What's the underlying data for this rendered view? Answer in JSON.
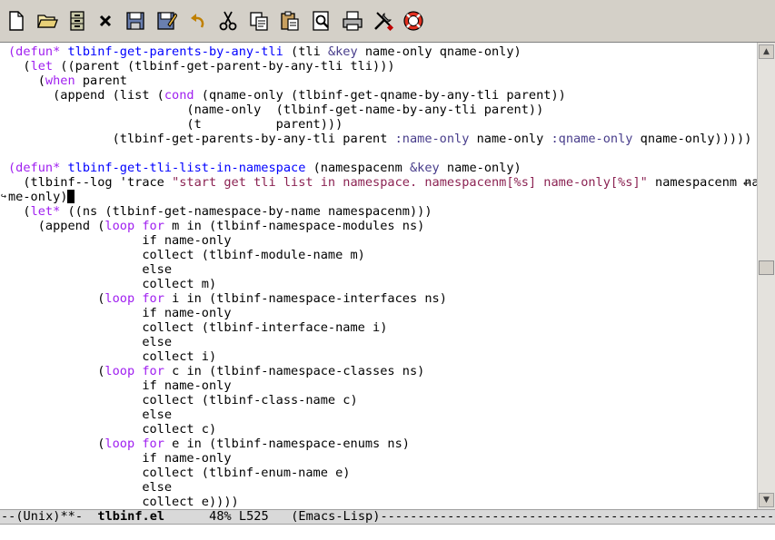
{
  "toolbar": {
    "buttons": [
      {
        "name": "new-file-icon",
        "tooltip": "new"
      },
      {
        "name": "open-folder-icon",
        "tooltip": "open"
      },
      {
        "name": "dired-cabinet-icon",
        "tooltip": "dired"
      },
      {
        "name": "close-icon",
        "tooltip": "close"
      },
      {
        "name": "save-icon",
        "tooltip": "save"
      },
      {
        "name": "save-as-icon",
        "tooltip": "save as"
      },
      {
        "name": "undo-icon",
        "tooltip": "undo"
      },
      {
        "name": "cut-icon",
        "tooltip": "cut"
      },
      {
        "name": "copy-icon",
        "tooltip": "copy"
      },
      {
        "name": "paste-icon",
        "tooltip": "paste"
      },
      {
        "name": "search-icon",
        "tooltip": "search"
      },
      {
        "name": "print-icon",
        "tooltip": "print"
      },
      {
        "name": "preferences-icon",
        "tooltip": "preferences"
      },
      {
        "name": "help-icon",
        "tooltip": "help"
      }
    ]
  },
  "colors": {
    "keyword": "#a020f0",
    "function_name": "#0000ff",
    "string": "#8b2252",
    "keyword_symbol": "#483d8b",
    "modeline_bg": "#d9d9d9",
    "toolbar_bg": "#d4d0c8"
  },
  "editor": {
    "lines": [
      [
        [
          "kw",
          "(defun*"
        ],
        [
          "t",
          " "
        ],
        [
          "fn",
          "tlbinf-get-parents-by-any-tli"
        ],
        [
          "t",
          " (tli "
        ],
        [
          "ks",
          "&key"
        ],
        [
          "t",
          " name-only qname-only)"
        ]
      ],
      [
        [
          "t",
          "  ("
        ],
        [
          "kw",
          "let"
        ],
        [
          "t",
          " ((parent (tlbinf-get-parent-by-any-tli tli)))"
        ]
      ],
      [
        [
          "t",
          "    ("
        ],
        [
          "kw",
          "when"
        ],
        [
          "t",
          " parent"
        ]
      ],
      [
        [
          "t",
          "      (append (list ("
        ],
        [
          "kw",
          "cond"
        ],
        [
          "t",
          " (qname-only (tlbinf-get-qname-by-any-tli parent))"
        ]
      ],
      [
        [
          "t",
          "                        (name-only  (tlbinf-get-name-by-any-tli parent))"
        ]
      ],
      [
        [
          "t",
          "                        (t          parent)))"
        ]
      ],
      [
        [
          "t",
          "              (tlbinf-get-parents-by-any-tli parent "
        ],
        [
          "ks",
          ":name-only"
        ],
        [
          "t",
          " name-only "
        ],
        [
          "ks",
          ":qname-only"
        ],
        [
          "t",
          " qname-only)))))"
        ]
      ],
      [
        [
          "t",
          ""
        ]
      ],
      [
        [
          "kw",
          "(defun*"
        ],
        [
          "t",
          " "
        ],
        [
          "fn",
          "tlbinf-get-tli-list-in-namespace"
        ],
        [
          "t",
          " (namespacenm "
        ],
        [
          "ks",
          "&key"
        ],
        [
          "t",
          " name-only)"
        ]
      ],
      [
        [
          "t",
          "  (tlbinf--log 'trace "
        ],
        [
          "st",
          "\"start get tli list in namespace. namespacenm[%s] name-only[%s]\""
        ],
        [
          "t",
          " namespacenm na"
        ]
      ],
      [
        [
          "t",
          "me-only)"
        ]
      ],
      [
        [
          "t",
          "  ("
        ],
        [
          "kw",
          "let*"
        ],
        [
          "t",
          " ((ns (tlbinf-get-namespace-by-name namespacenm)))"
        ]
      ],
      [
        [
          "t",
          "    (append ("
        ],
        [
          "kw",
          "loop"
        ],
        [
          "t",
          " "
        ],
        [
          "kw",
          "for"
        ],
        [
          "t",
          " m in (tlbinf-namespace-modules ns)"
        ]
      ],
      [
        [
          "t",
          "                  if name-only"
        ]
      ],
      [
        [
          "t",
          "                  collect (tlbinf-module-name m)"
        ]
      ],
      [
        [
          "t",
          "                  else"
        ]
      ],
      [
        [
          "t",
          "                  collect m)"
        ]
      ],
      [
        [
          "t",
          "            ("
        ],
        [
          "kw",
          "loop"
        ],
        [
          "t",
          " "
        ],
        [
          "kw",
          "for"
        ],
        [
          "t",
          " i in (tlbinf-namespace-interfaces ns)"
        ]
      ],
      [
        [
          "t",
          "                  if name-only"
        ]
      ],
      [
        [
          "t",
          "                  collect (tlbinf-interface-name i)"
        ]
      ],
      [
        [
          "t",
          "                  else"
        ]
      ],
      [
        [
          "t",
          "                  collect i)"
        ]
      ],
      [
        [
          "t",
          "            ("
        ],
        [
          "kw",
          "loop"
        ],
        [
          "t",
          " "
        ],
        [
          "kw",
          "for"
        ],
        [
          "t",
          " c in (tlbinf-namespace-classes ns)"
        ]
      ],
      [
        [
          "t",
          "                  if name-only"
        ]
      ],
      [
        [
          "t",
          "                  collect (tlbinf-class-name c)"
        ]
      ],
      [
        [
          "t",
          "                  else"
        ]
      ],
      [
        [
          "t",
          "                  collect c)"
        ]
      ],
      [
        [
          "t",
          "            ("
        ],
        [
          "kw",
          "loop"
        ],
        [
          "t",
          " "
        ],
        [
          "kw",
          "for"
        ],
        [
          "t",
          " e in (tlbinf-namespace-enums ns)"
        ]
      ],
      [
        [
          "t",
          "                  if name-only"
        ]
      ],
      [
        [
          "t",
          "                  collect (tlbinf-enum-name e)"
        ]
      ],
      [
        [
          "t",
          "                  else"
        ]
      ],
      [
        [
          "t",
          "                  collect e))))"
        ]
      ]
    ],
    "cursor_line": 10,
    "wrap_right_line": 9,
    "wrap_left_line": 10,
    "wrap_right_glyph": "↵",
    "wrap_left_glyph": "↪"
  },
  "scrollbar": {
    "up_arrow": "▲",
    "down_arrow": "▼",
    "position_fraction": 0.48
  },
  "modeline": {
    "prefix": "--(Unix)**-  ",
    "buffer": "tlbinf.el",
    "position": "      48% L525   ",
    "mode": "(Emacs-Lisp)",
    "suffix": "-----------------------------------------------------------------------"
  },
  "minibuffer": {
    "text": ""
  }
}
